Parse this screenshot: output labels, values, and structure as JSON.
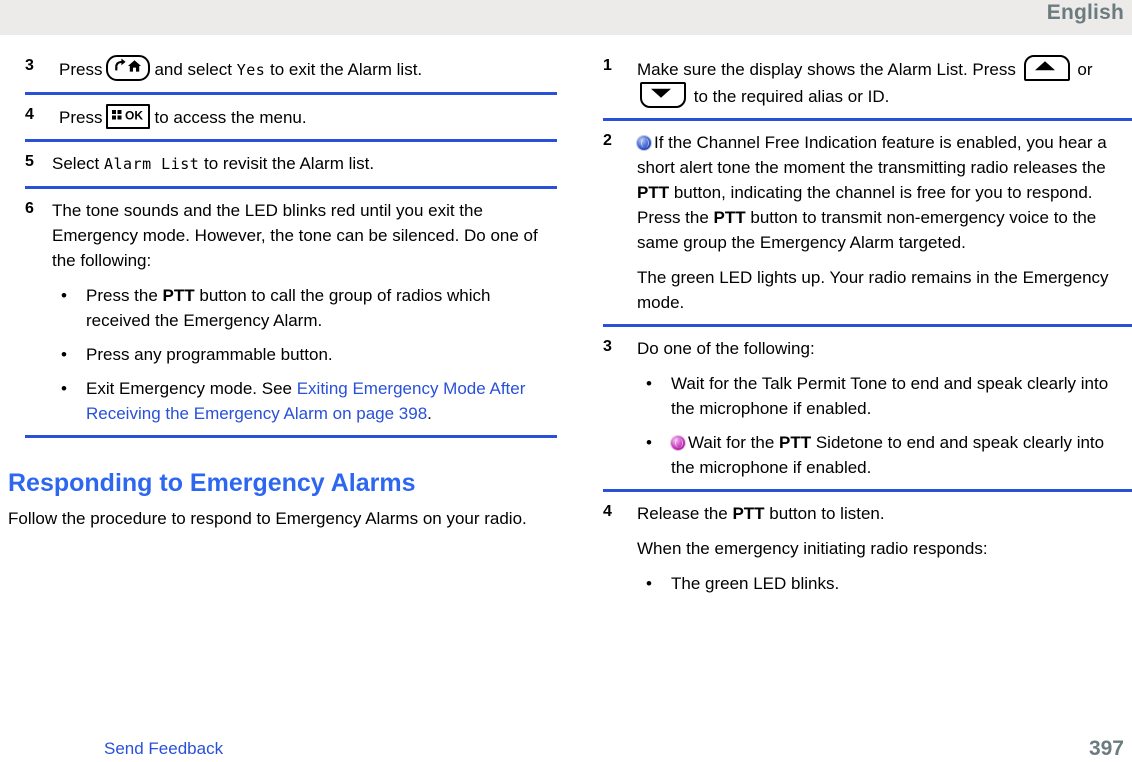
{
  "header": {
    "language": "English"
  },
  "colors": {
    "link": "#2850d8",
    "heading": "#2d67f0",
    "divider": "#2850d8",
    "header_text": "#6b7b7f",
    "header_band": "#ecebe9"
  },
  "left_column": {
    "steps": [
      {
        "number": "3",
        "text_before_key": "Press",
        "key_icon": "back-home-key-icon",
        "text_after_key": "and select",
        "mono_value": "Yes",
        "text_end": "to exit the Alarm list."
      },
      {
        "number": "4",
        "text_before_key": "Press",
        "key_icon": "menu-ok-key-icon",
        "text_after_key": "to access the menu."
      },
      {
        "number": "5",
        "text_before_key": "Select",
        "mono_value": "Alarm List",
        "text_end": "to revisit the Alarm list."
      },
      {
        "number": "6",
        "paragraph": "The tone sounds and the LED blinks red until you exit the Emergency mode. However, the tone can be silenced. Do one of the following:",
        "bullets": [
          {
            "pre": "Press the ",
            "bold": "PTT",
            "post": " button to call the group of radios which received the Emergency Alarm."
          },
          {
            "pre": "Press any programmable button.",
            "bold": "",
            "post": ""
          },
          {
            "pre": "Exit Emergency mode. See ",
            "link": "Exiting Emergency Mode After Receiving the Emergency Alarm on page 398",
            "post": "."
          }
        ]
      }
    ],
    "section": {
      "heading": "Responding to Emergency Alarms",
      "paragraph": "Follow the procedure to respond to Emergency Alarms on your radio."
    }
  },
  "right_column": {
    "steps": [
      {
        "number": "1",
        "text_before": "Make sure the display shows the Alarm List. Press",
        "key_up_icon": "up-arrow-key-icon",
        "conjunction": "or",
        "key_down_icon": "down-arrow-key-icon",
        "text_after": "to the required alias or ID."
      },
      {
        "number": "2",
        "note_icon": "blue-globe-note-icon",
        "para1_a": "If the Channel Free Indication feature is enabled, you hear a short alert tone the moment the transmitting radio releases the ",
        "para1_bold1": "PTT",
        "para1_b": " button, indicating the channel is free for you to respond. Press the ",
        "para1_bold2": "PTT",
        "para1_c": " button to transmit non-emergency voice to the same group the Emergency Alarm targeted.",
        "para2": "The green LED lights up. Your radio remains in the Emergency mode."
      },
      {
        "number": "3",
        "paragraph": "Do one of the following:",
        "bullets": [
          {
            "note_icon": "",
            "pre": "Wait for the Talk Permit Tone to end and speak clearly into the microphone if enabled.",
            "bold": "",
            "post": ""
          },
          {
            "note_icon": "magenta-globe-note-icon",
            "pre": "Wait for the ",
            "bold": "PTT",
            "post": " Sidetone to end and speak clearly into the microphone if enabled."
          }
        ]
      },
      {
        "number": "4",
        "para_pre": "Release the ",
        "para_bold": "PTT",
        "para_post": " button to listen.",
        "para2": "When the emergency initiating radio responds:",
        "bullets": [
          {
            "pre": "The green LED blinks.",
            "bold": "",
            "post": ""
          }
        ]
      }
    ]
  },
  "footer": {
    "feedback_label": "Send Feedback",
    "page_number": "397"
  },
  "bullet_glyph": "•"
}
